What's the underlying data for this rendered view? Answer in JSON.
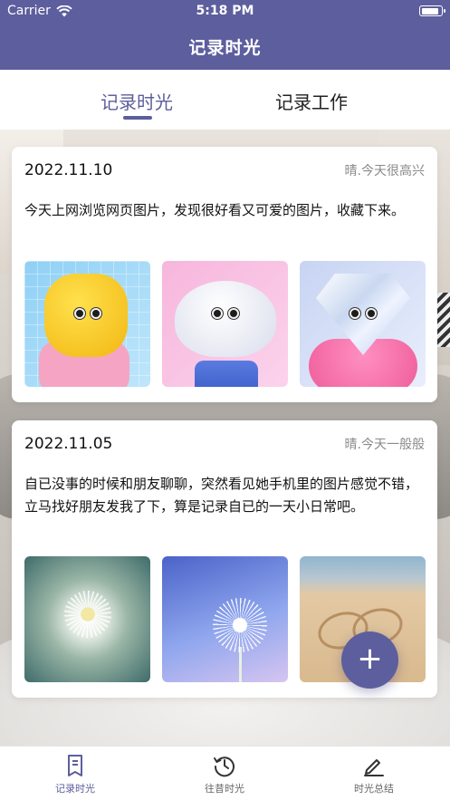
{
  "status_bar": {
    "carrier": "Carrier",
    "time": "5:18 PM",
    "battery_level": 0.9
  },
  "nav": {
    "title": "记录时光"
  },
  "segments": [
    {
      "label": "记录时光",
      "active": true
    },
    {
      "label": "记录工作",
      "active": false
    }
  ],
  "entries": [
    {
      "date": "2022.11.10",
      "mood": "晴.今天很高兴",
      "text": "今天上网浏览网页图片，发现很好看又可爱的图片，收藏下来。",
      "photos": [
        "yellow-flower-character",
        "cloud-character",
        "diamond-character"
      ]
    },
    {
      "date": "2022.11.05",
      "mood": "晴.今天一般般",
      "text": "自已没事的时候和朋友聊聊，突然看见她手机里的图片感觉不错，立马找好朋友发我了下，算是记录自已的一天小日常吧。",
      "photos": [
        "dandelion-close-up",
        "dandelion-blue-sky",
        "hearts-in-sand"
      ]
    }
  ],
  "fab": {
    "label": "+"
  },
  "tabbar": [
    {
      "label": "记录时光",
      "icon": "notebook-icon",
      "active": true
    },
    {
      "label": "往昔时光",
      "icon": "history-clock-icon",
      "active": false
    },
    {
      "label": "时光总结",
      "icon": "pencil-icon",
      "active": false
    }
  ],
  "colors": {
    "primary": "#5d5e9d",
    "text": "#111111",
    "muted": "#8a8a8a"
  }
}
